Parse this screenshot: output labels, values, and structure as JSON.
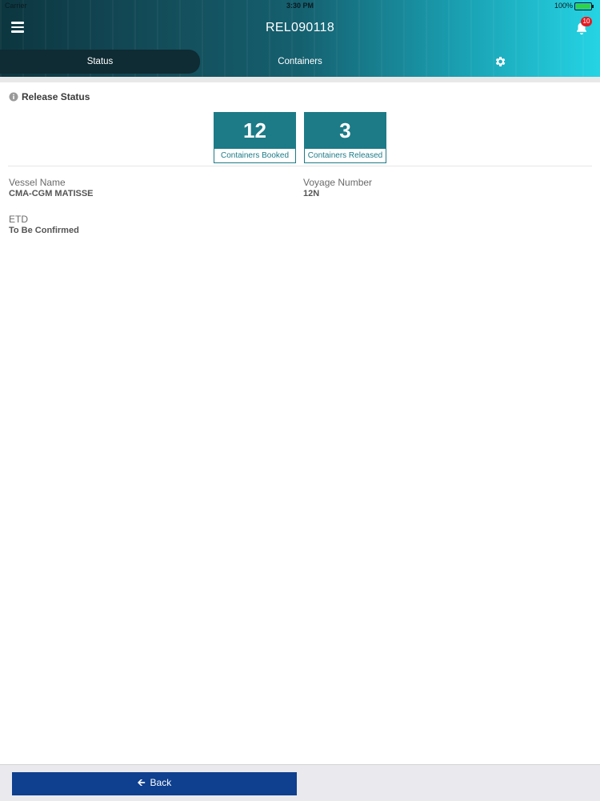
{
  "status_bar": {
    "carrier": "Carrier",
    "time": "3:30 PM",
    "battery": "100%"
  },
  "header": {
    "title": "REL090118",
    "notification_count": "10"
  },
  "tabs": [
    {
      "label": "Status",
      "active": true
    },
    {
      "label": "Containers",
      "active": false
    },
    {
      "icon": "gear-icon"
    }
  ],
  "release_status": {
    "title": "Release Status",
    "booked": {
      "value": "12",
      "label": "Containers Booked"
    },
    "released": {
      "value": "3",
      "label": "Containers Released"
    }
  },
  "details": {
    "vessel_name_label": "Vessel Name",
    "vessel_name_value": "CMA-CGM MATISSE",
    "voyage_number_label": "Voyage Number",
    "voyage_number_value": "12N",
    "etd_label": "ETD",
    "etd_value": "To Be Confirmed"
  },
  "footer": {
    "back_label": "Back"
  },
  "colors": {
    "accent": "#1c7b87",
    "back_button": "#0f3f8f",
    "badge": "#e21b23"
  }
}
